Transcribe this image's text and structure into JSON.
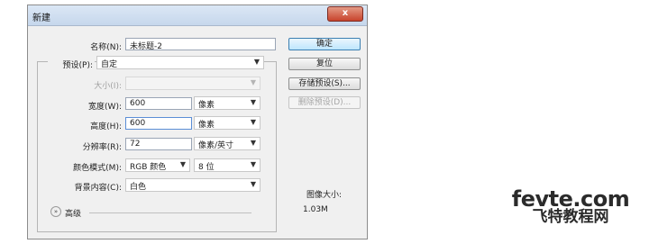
{
  "dialog": {
    "title": "新建",
    "close_label": "x",
    "name": {
      "label": "名称(N):",
      "value": "未标题-2"
    },
    "preset": {
      "label": "预设(P):",
      "value": "自定"
    },
    "size": {
      "label": "大小(I):",
      "value": ""
    },
    "width": {
      "label": "宽度(W):",
      "value": "600",
      "unit": "像素"
    },
    "height": {
      "label": "高度(H):",
      "value": "600",
      "unit": "像素"
    },
    "resolution": {
      "label": "分辨率(R):",
      "value": "72",
      "unit": "像素/英寸"
    },
    "color_mode": {
      "label": "颜色模式(M):",
      "value": "RGB 颜色",
      "depth": "8 位"
    },
    "background": {
      "label": "背景内容(C):",
      "value": "白色"
    },
    "advanced": {
      "label": "高级"
    },
    "image_size": {
      "label": "图像大小:",
      "value": "1.03M"
    },
    "buttons": {
      "ok": "确定",
      "reset": "复位",
      "save_preset": "存储预设(S)...",
      "delete_preset": "删除预设(D)..."
    }
  },
  "watermark": {
    "line1": "fevte.com",
    "line2": "飞特教程网"
  }
}
